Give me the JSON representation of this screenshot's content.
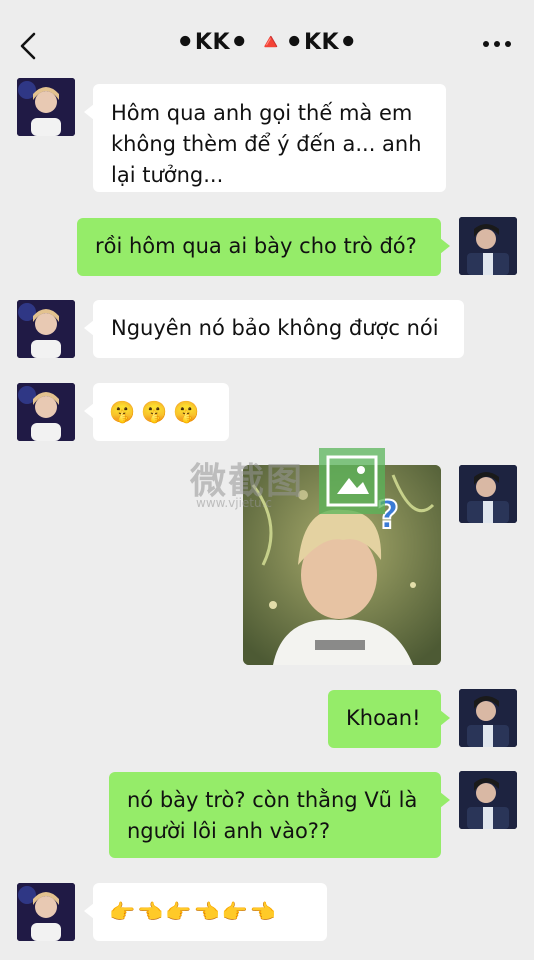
{
  "header": {
    "title": "⚫KK⚫ 🔺⚫KK⚫",
    "back_icon": "chevron-left-icon",
    "more_icon": "more-dots-icon"
  },
  "messages": [
    {
      "from": "them",
      "lines": [
        "Hôm qua anh gọi thế mà em",
        "không thèm để ý đến a... anh",
        "lại tưởng..."
      ]
    },
    {
      "from": "me",
      "text": "rồi hôm qua ai bày cho trò đó?"
    },
    {
      "from": "them",
      "text": "Nguyên nó bảo không được nói"
    },
    {
      "from": "them",
      "emoji": [
        "🤫",
        "🤫",
        "🤫"
      ]
    },
    {
      "from": "me",
      "type": "image",
      "overlay": "?"
    },
    {
      "from": "me",
      "text": "Khoan!"
    },
    {
      "from": "me",
      "lines": [
        "nó bày trò? còn thằng Vũ là",
        "người lôi anh vào??"
      ]
    },
    {
      "from": "them",
      "emoji": [
        "👉",
        "👈",
        "👉",
        "👈",
        "👉",
        "👈"
      ]
    }
  ],
  "watermark": {
    "text": "微截图",
    "sub": "www.vjietu.c"
  },
  "colors": {
    "bg": "#ededed",
    "incoming": "#ffffff",
    "outgoing": "#95ec69"
  }
}
